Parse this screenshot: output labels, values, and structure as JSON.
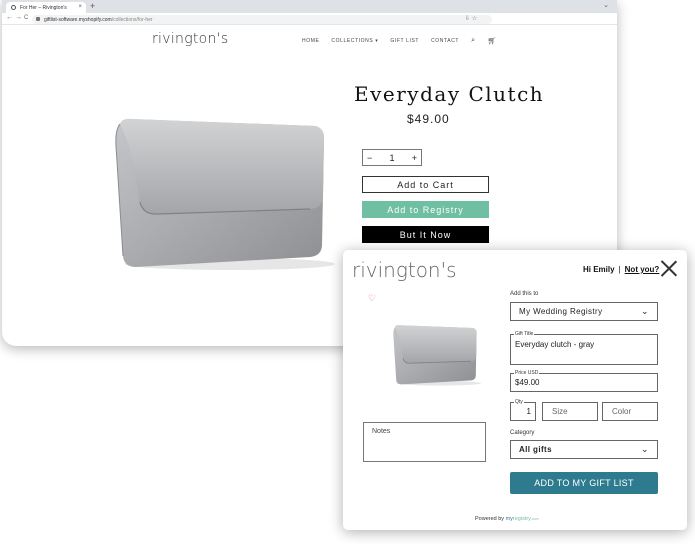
{
  "browser": {
    "tab_title": "For Her – Rivington's",
    "new_tab": "+",
    "url_host": "giftlist-software.myshopify.com",
    "url_path": "/collections/for-her",
    "back": "←",
    "forward": "→",
    "reload": "C"
  },
  "store": {
    "brand": "rivington's",
    "nav": [
      "HOME",
      "COLLECTIONS ▾",
      "GIFT LIST",
      "CONTACT"
    ]
  },
  "product": {
    "title": "Everyday Clutch",
    "price": "$49.00",
    "qty_minus": "−",
    "qty_value": "1",
    "qty_plus": "+",
    "add_to_cart": "Add to Cart",
    "add_to_registry": "Add to Registry",
    "buy_now": "But It Now"
  },
  "popup": {
    "brand": "rivington's",
    "greeting": "Hi Emily",
    "separator": "|",
    "not_you": "Not you?",
    "add_this_to_label": "Add this to",
    "registry_selected": "My Wedding Registry",
    "gift_title_legend": "Gift Title",
    "gift_title_value": "Everyday clutch - gray",
    "price_legend": "Price USD",
    "price_value": "$49.00",
    "qty_legend": "Qty",
    "qty_value": "1",
    "size_placeholder": "Size",
    "color_placeholder": "Color",
    "notes_placeholder": "Notes",
    "category_label": "Category",
    "category_selected": "All gifts",
    "add_button": "ADD TO MY GIFT LIST",
    "powered_by": "Powered by",
    "powered_my": "my",
    "powered_registry": "registry",
    "powered_com": ".com"
  },
  "colors": {
    "registry_green": "#6fbfa2",
    "add_button_teal": "#2e7b8f",
    "heart_red": "#e05a5a"
  }
}
